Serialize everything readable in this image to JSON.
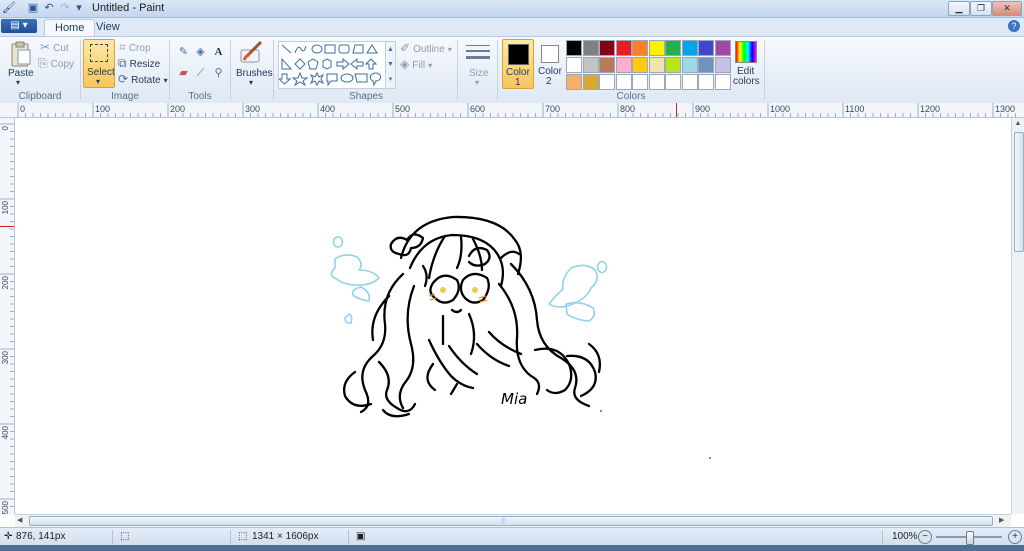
{
  "window": {
    "title": "Untitled - Paint"
  },
  "tabs": [
    {
      "label": "Home",
      "active": true
    },
    {
      "label": "View",
      "active": false
    }
  ],
  "ribbon": {
    "clipboard": {
      "group_label": "Clipboard",
      "paste": "Paste",
      "cut": "Cut",
      "copy": "Copy"
    },
    "image": {
      "group_label": "Image",
      "select": "Select",
      "crop": "Crop",
      "resize": "Resize",
      "rotate": "Rotate"
    },
    "tools": {
      "group_label": "Tools"
    },
    "brushes": {
      "label": "Brushes"
    },
    "shapes": {
      "group_label": "Shapes",
      "outline": "Outline",
      "fill": "Fill"
    },
    "size": {
      "label": "Size"
    },
    "color1": {
      "label": "Color",
      "num": "1",
      "color": "#000000"
    },
    "color2": {
      "label": "Color",
      "num": "2",
      "color": "#ffffff"
    },
    "colors": {
      "group_label": "Colors",
      "edit_colors_line1": "Edit",
      "edit_colors_line2": "colors",
      "row1": [
        "#000000",
        "#7f7f7f",
        "#880015",
        "#ed1c24",
        "#ff7f27",
        "#fff200",
        "#22b14c",
        "#00a2e8",
        "#3f48cc",
        "#a349a4"
      ],
      "row2": [
        "#ffffff",
        "#c3c3c3",
        "#b97a57",
        "#ffaec9",
        "#ffc90e",
        "#efe4b0",
        "#b5e61d",
        "#99d9ea",
        "#7092be",
        "#c8bfe7"
      ],
      "row3": [
        "#f7b066",
        "#d9a834",
        "#ffffff",
        "#ffffff",
        "#ffffff",
        "#ffffff",
        "#ffffff",
        "#ffffff",
        "#ffffff",
        "#ffffff"
      ]
    }
  },
  "ruler": {
    "h_ticks": [
      "0",
      "100",
      "200",
      "300",
      "400",
      "500",
      "600",
      "700",
      "800",
      "900",
      "1000",
      "1100",
      "1200",
      "1300"
    ],
    "v_ticks": [
      "0",
      "100",
      "200",
      "300",
      "400",
      "500"
    ]
  },
  "canvas": {
    "signature": "Mia",
    "line_color": "#000000",
    "accent_color": "#8fd3ea"
  },
  "status": {
    "cursor_pos": "876, 141px",
    "image_size": "1341 × 1606px",
    "zoom": "100%"
  }
}
